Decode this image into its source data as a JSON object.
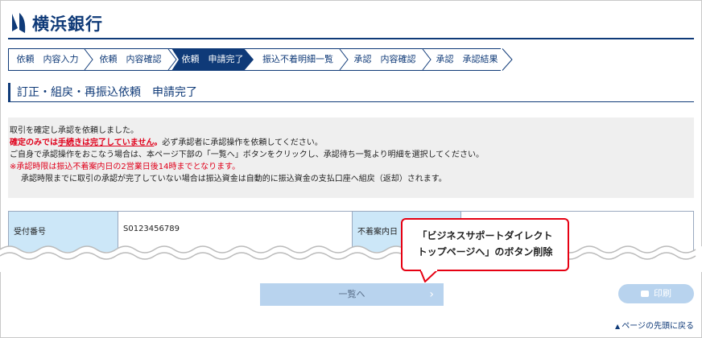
{
  "brand": {
    "name": "横浜銀行",
    "color": "#0f3a78"
  },
  "steps": [
    {
      "label": "依頼　内容入力",
      "active": false
    },
    {
      "label": "依頼　内容確認",
      "active": false
    },
    {
      "label": "依頼　申請完了",
      "active": true
    },
    {
      "label": "振込不着明細一覧",
      "active": false
    },
    {
      "label": "承認　内容確認",
      "active": false
    },
    {
      "label": "承認　承認結果",
      "active": false
    }
  ],
  "page_title": "訂正・組戻・再振込依頼　申請完了",
  "notice": {
    "line1": "取引を確定し承認を依頼しました。",
    "line2_bold_a": "確定のみでは",
    "line2_bold_ul": "手続きは完了していません",
    "line2_bold_b": "。",
    "line2_rest": "必ず承認者に承認操作を依頼してください。",
    "line3": "ご自身で承認操作をおこなう場合は、本ページ下部の「一覧へ」ボタンをクリックし、承認待ち一覧より明細を選択してください。",
    "line4": "※承認時限は振込不着案内日の2営業日後14時までとなります。",
    "line5": "承認時限までに取引の承認が完了していない場合は振込資金は自動的に振込資金の支払口座へ組戻（返却）されます。"
  },
  "table": {
    "receipt_label": "受付番号",
    "receipt_value": "S0123456789",
    "notice_date_label": "不着案内日"
  },
  "callout": {
    "line1": "「ビジネスサポートダイレクト",
    "line2": "トップページへ」のボタン削除"
  },
  "buttons": {
    "next_label": "一覧へ",
    "print_label": "印刷"
  },
  "links": {
    "page_top": "ページの先頭に戻る"
  },
  "colors": {
    "accent": "#0f3a78",
    "alert": "#e0001b",
    "button": "#b8d3ee",
    "header_cell": "#cce7f8"
  }
}
